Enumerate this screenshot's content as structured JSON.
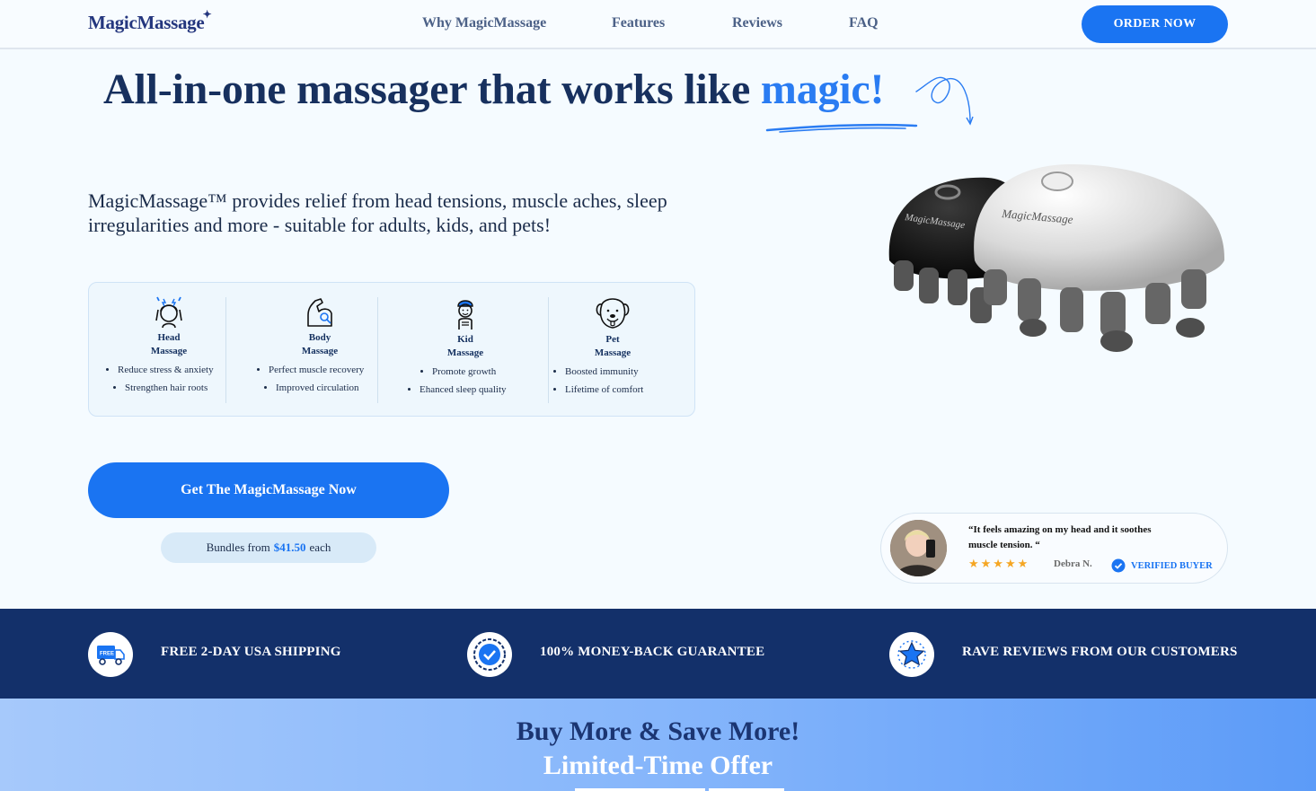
{
  "header": {
    "logo": "MagicMassage",
    "logo_mark": "✦",
    "nav": [
      "Why MagicMassage",
      "Features",
      "Reviews",
      "FAQ"
    ],
    "order_button": "ORDER NOW"
  },
  "hero": {
    "title_main": "All-in-one massager that works like ",
    "title_accent": "magic!",
    "subtitle": "MagicMassage™ provides relief from head tensions, muscle aches, sleep irregularities and more - suitable for adults, kids, and pets!"
  },
  "massage_types": [
    {
      "name_line1": "Head",
      "name_line2": "Massage",
      "icon": "head-massage-icon",
      "benefits": [
        "Reduce stress & anxiety",
        "Strengthen hair roots"
      ]
    },
    {
      "name_line1": "Body",
      "name_line2": "Massage",
      "icon": "flexed-arm-icon",
      "benefits": [
        "Perfect muscle recovery",
        "Improved circulation"
      ]
    },
    {
      "name_line1": "Kid",
      "name_line2": "Massage",
      "icon": "kid-icon",
      "benefits": [
        "Promote growth",
        "Ehanced sleep quality"
      ]
    },
    {
      "name_line1": "Pet",
      "name_line2": "Massage",
      "icon": "dog-icon",
      "benefits": [
        "Boosted immunity",
        "Lifetime of comfort"
      ]
    }
  ],
  "cta": {
    "button": "Get The MagicMassage Now",
    "bundle_prefix": "Bundles from",
    "bundle_price": "$41.50",
    "bundle_suffix": "each"
  },
  "product": {
    "brand_text": "MagicMassage"
  },
  "review": {
    "quote": "“It feels amazing on my head and it soothes muscle tension. “",
    "stars": "★★★★★",
    "rating": 5,
    "reviewer": "Debra N.",
    "badge": "VERIFIED BUYER"
  },
  "trust_bar": [
    {
      "icon": "free-shipping-truck-icon",
      "icon_label": "FREE",
      "text": "FREE 2-DAY USA SHIPPING"
    },
    {
      "icon": "guarantee-badge-icon",
      "text": "100% MONEY-BACK GUARANTEE"
    },
    {
      "icon": "star-icon",
      "text": "RAVE REVIEWS FROM OUR CUSTOMERS"
    }
  ],
  "offer": {
    "heading": "Buy More & Save More!",
    "subheading": "Limited-Time Offer"
  },
  "colors": {
    "primary": "#1a74f2",
    "navy": "#13306a",
    "heading": "#17305e",
    "star": "#f5a623"
  }
}
